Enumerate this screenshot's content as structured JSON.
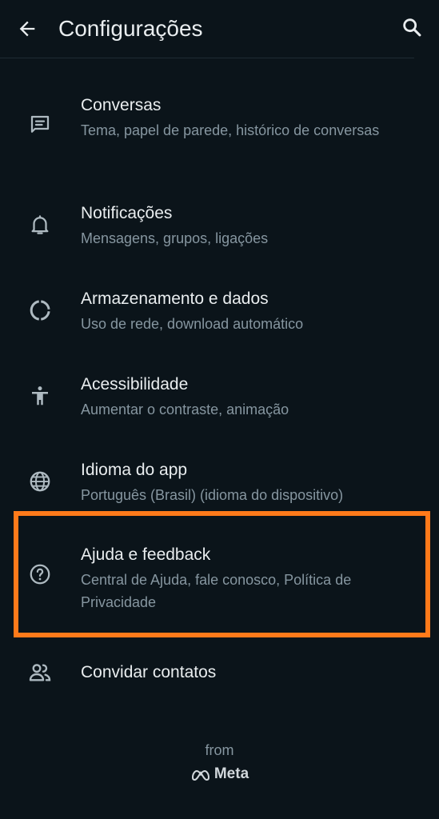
{
  "header": {
    "title": "Configurações",
    "back_icon": "arrow-left-icon",
    "search_icon": "search-icon"
  },
  "settings": [
    {
      "id": "chats",
      "icon": "chat-lines-icon",
      "label": "Conversas",
      "sub": "Tema, papel de parede, histórico de conversas"
    },
    {
      "id": "notifications",
      "icon": "bell-icon",
      "label": "Notificações",
      "sub": "Mensagens, grupos, ligações"
    },
    {
      "id": "storage",
      "icon": "storage-ring-icon",
      "label": "Armazenamento e dados",
      "sub": "Uso de rede, download automático"
    },
    {
      "id": "accessibility",
      "icon": "accessibility-person-icon",
      "label": "Acessibilidade",
      "sub": "Aumentar o contraste, animação"
    },
    {
      "id": "language",
      "icon": "globe-icon",
      "label": "Idioma do app",
      "sub": "Português (Brasil) (idioma do dispositivo)"
    },
    {
      "id": "help",
      "icon": "help-circle-icon",
      "label": "Ajuda e feedback",
      "sub": "Central de Ajuda, fale conosco, Política de Privacidade"
    },
    {
      "id": "invite",
      "icon": "people-icon",
      "label": "Convidar contatos",
      "sub": ""
    }
  ],
  "footer": {
    "from": "from",
    "brand": "Meta"
  },
  "colors": {
    "background": "#0b141a",
    "primary_text": "#e9edef",
    "secondary_text": "#8696a0",
    "highlight_border": "#ff7a1a"
  }
}
